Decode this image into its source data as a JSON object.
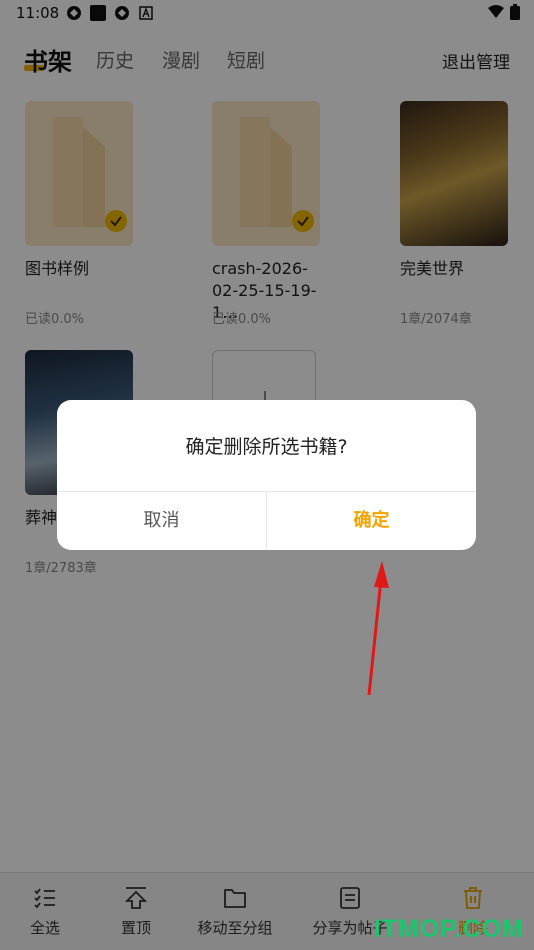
{
  "status_bar": {
    "time": "11:08"
  },
  "header": {
    "tabs": [
      {
        "label": "书架",
        "active": true
      },
      {
        "label": "历史",
        "active": false
      },
      {
        "label": "漫剧",
        "active": false
      },
      {
        "label": "短剧",
        "active": false
      }
    ],
    "exit_manage_label": "退出管理",
    "accent_color": "#f5b400"
  },
  "books": [
    {
      "title": "图书样例",
      "progress": "已读0.0%",
      "selected": true
    },
    {
      "title": "crash-2026-02-25-15-19-1…",
      "progress": "已读0.0%",
      "selected": true
    },
    {
      "title": "完美世界",
      "progress": "1章/2074章",
      "selected": false
    },
    {
      "title": "葬神",
      "progress": "1章/2783章",
      "selected": false
    }
  ],
  "dialog": {
    "message": "确定删除所选书籍?",
    "cancel_label": "取消",
    "confirm_label": "确定",
    "confirm_color": "#f5a300"
  },
  "toolbar": {
    "items": [
      {
        "label": "全选",
        "icon": "select-all-icon"
      },
      {
        "label": "置顶",
        "icon": "pin-top-icon"
      },
      {
        "label": "移动至分组",
        "icon": "folder-icon"
      },
      {
        "label": "分享为帖子",
        "icon": "share-post-icon"
      },
      {
        "label": "删除",
        "icon": "trash-icon"
      }
    ]
  },
  "watermark": "ITMOP.COM"
}
